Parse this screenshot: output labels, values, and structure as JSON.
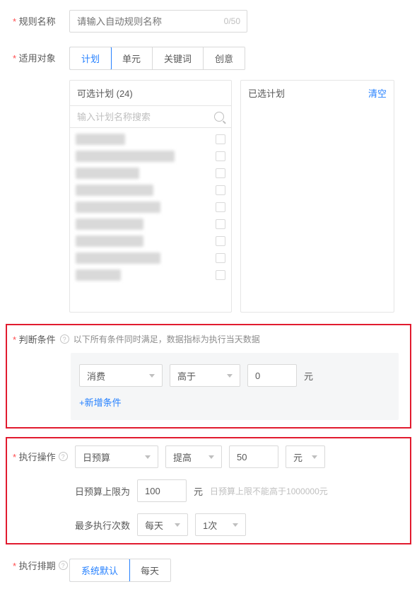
{
  "ruleName": {
    "label": "规则名称",
    "placeholder": "请输入自动规则名称",
    "counter": "0/50"
  },
  "target": {
    "label": "适用对象",
    "options": [
      "计划",
      "单元",
      "关键词",
      "创意"
    ],
    "activeIndex": 0,
    "leftPanel": {
      "title": "可选计划  (24)",
      "searchPlaceholder": "输入计划名称搜索",
      "items": [
        70,
        140,
        90,
        110,
        120,
        96,
        96,
        120,
        64
      ]
    },
    "rightPanel": {
      "title": "已选计划",
      "clear": "清空"
    }
  },
  "condition": {
    "label": "判断条件",
    "hint": "以下所有条件同时满足，数据指标为执行当天数据",
    "metric": "消费",
    "op": "高于",
    "value": "0",
    "unit": "元",
    "addLink": "+新增条件"
  },
  "action": {
    "label": "执行操作",
    "target": "日预算",
    "direction": "提高",
    "amount": "50",
    "unit": "元",
    "capLabel": "日预算上限为",
    "capValue": "100",
    "capUnit": "元",
    "capHint": "日预算上限不能高于1000000元",
    "maxExecLabel": "最多执行次数",
    "maxExecFreq": "每天",
    "maxExecCount": "1次"
  },
  "schedule": {
    "label": "执行排期",
    "options": [
      "系统默认",
      "每天"
    ],
    "activeIndex": 0
  }
}
